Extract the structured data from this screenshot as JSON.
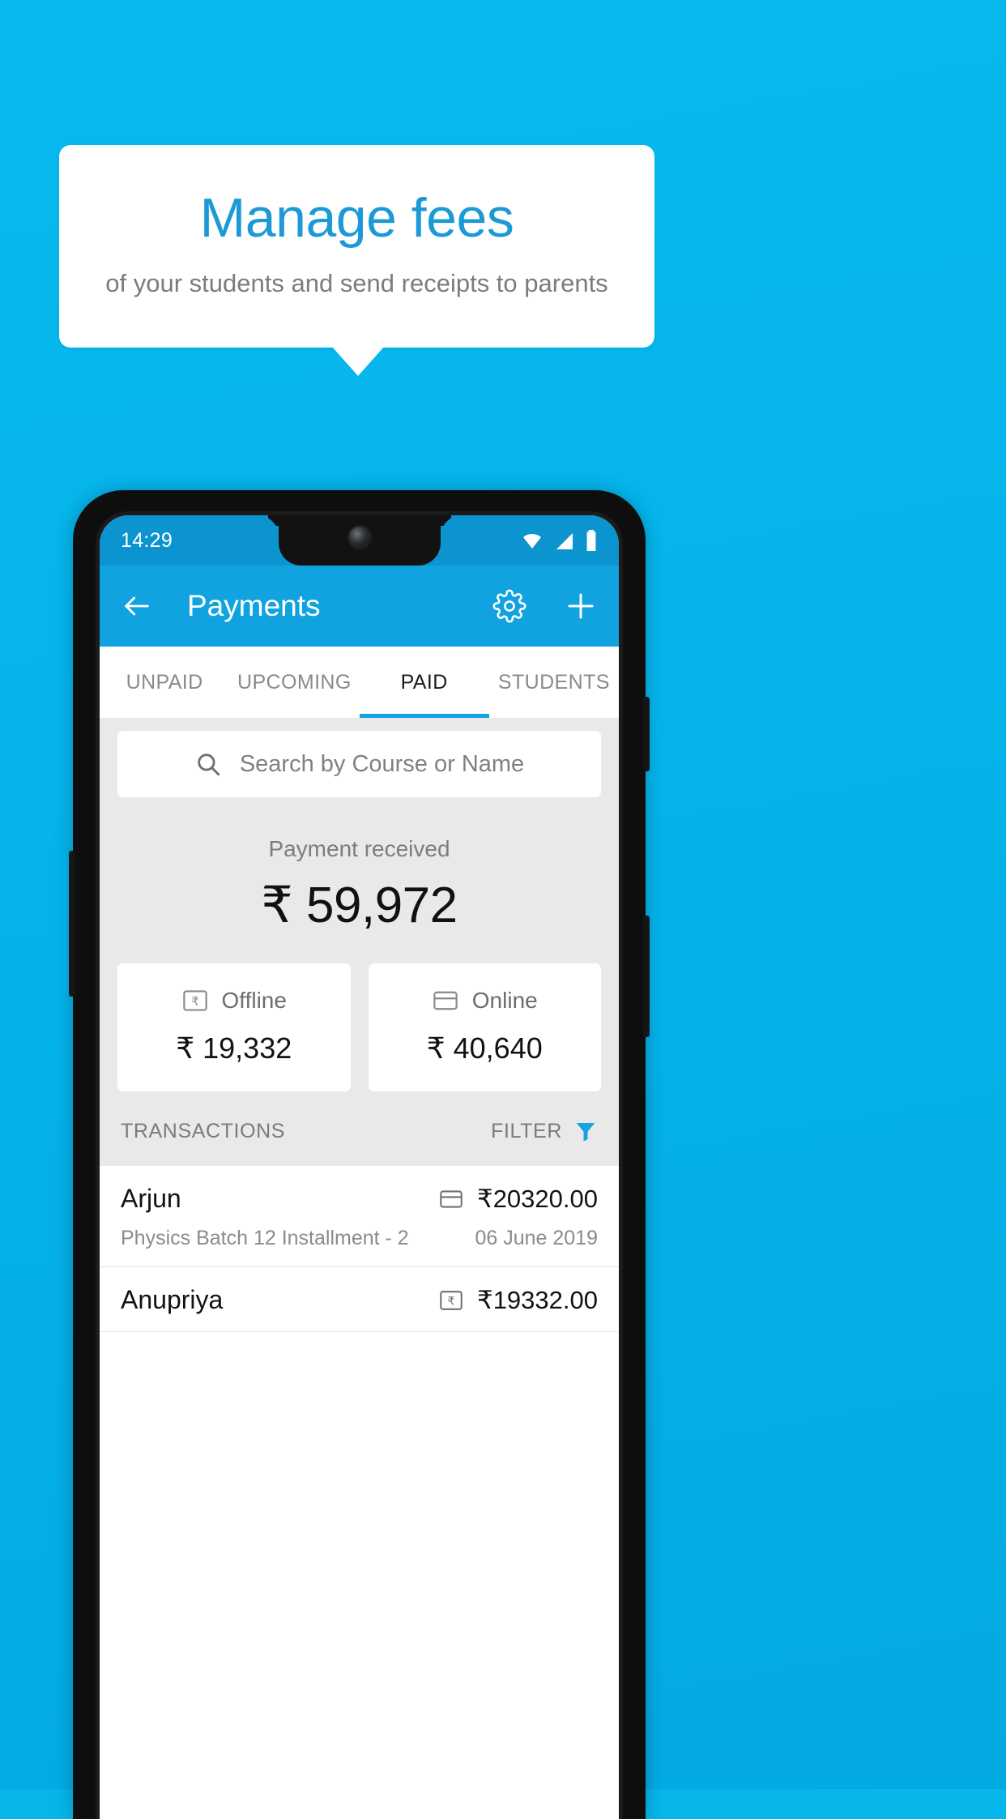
{
  "promo": {
    "title": "Manage fees",
    "subtitle": "of your students and send receipts to parents",
    "title_color": "#1b9ad6",
    "background_color": "#06b6ea"
  },
  "phone": {
    "status_bar": {
      "time": "14:29",
      "icons": [
        "wifi-icon",
        "signal-icon",
        "battery-icon"
      ]
    },
    "appbar": {
      "back_icon": "arrow-back-icon",
      "title": "Payments",
      "settings_icon": "gear-icon",
      "add_icon": "plus-icon",
      "color": "#11a2e0"
    },
    "tabs": [
      {
        "label": "UNPAID",
        "active": false
      },
      {
        "label": "UPCOMING",
        "active": false
      },
      {
        "label": "PAID",
        "active": true
      },
      {
        "label": "STUDENTS",
        "active": false
      }
    ],
    "search": {
      "icon": "search-icon",
      "placeholder": "Search by Course or Name",
      "value": ""
    },
    "summary": {
      "label": "Payment received",
      "amount": "₹ 59,972"
    },
    "split_cards": [
      {
        "icon": "rupee-note-icon",
        "label": "Offline",
        "value": "₹ 19,332"
      },
      {
        "icon": "credit-card-icon",
        "label": "Online",
        "value": "₹ 40,640"
      }
    ],
    "transactions_header": {
      "title": "TRANSACTIONS",
      "filter_label": "FILTER",
      "filter_icon": "funnel-icon"
    },
    "transactions": [
      {
        "name": "Arjun",
        "icon": "credit-card-icon",
        "amount": "₹20320.00",
        "description": "Physics Batch 12 Installment - 2",
        "date": "06 June 2019"
      },
      {
        "name": "Anupriya",
        "icon": "rupee-note-icon",
        "amount": "₹19332.00",
        "description": "",
        "date": ""
      }
    ]
  }
}
